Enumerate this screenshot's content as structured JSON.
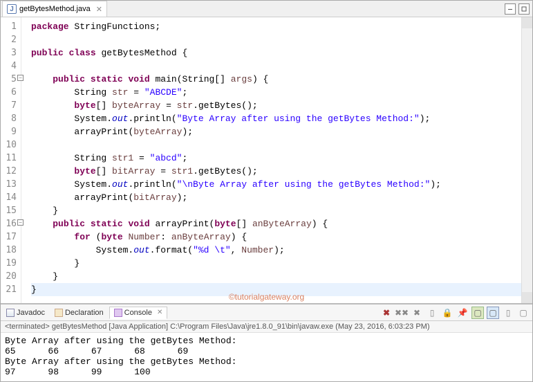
{
  "tab": {
    "filename": "getBytesMethod.java"
  },
  "code": {
    "lines": [
      {
        "n": 1,
        "html": "<span class='kw'>package</span> StringFunctions;"
      },
      {
        "n": 2,
        "html": ""
      },
      {
        "n": 3,
        "html": "<span class='kw'>public</span> <span class='kw'>class</span> getBytesMethod {"
      },
      {
        "n": 4,
        "html": ""
      },
      {
        "n": 5,
        "html": "    <span class='kw'>public</span> <span class='kw'>static</span> <span class='kw'>void</span> main(String[] <span class='mvar'>args</span>) {",
        "fold": true
      },
      {
        "n": 6,
        "html": "        String <span class='mvar'>str</span> = <span class='str'>\"ABCDE\"</span>;"
      },
      {
        "n": 7,
        "html": "        <span class='kw'>byte</span>[] <span class='mvar'>byteArray</span> = <span class='mvar'>str</span>.getBytes();"
      },
      {
        "n": 8,
        "html": "        System.<span class='field'>out</span>.println(<span class='str'>\"Byte Array after using the getBytes Method:\"</span>);"
      },
      {
        "n": 9,
        "html": "        <span class='cls'>arrayPrint</span>(<span class='mvar'>byteArray</span>);"
      },
      {
        "n": 10,
        "html": ""
      },
      {
        "n": 11,
        "html": "        String <span class='mvar'>str1</span> = <span class='str'>\"abcd\"</span>;"
      },
      {
        "n": 12,
        "html": "        <span class='kw'>byte</span>[] <span class='mvar'>bitArray</span> = <span class='mvar'>str1</span>.getBytes();"
      },
      {
        "n": 13,
        "html": "        System.<span class='field'>out</span>.println(<span class='str'>\"\\nByte Array after using the getBytes Method:\"</span>);"
      },
      {
        "n": 14,
        "html": "        <span class='cls'>arrayPrint</span>(<span class='mvar'>bitArray</span>);"
      },
      {
        "n": 15,
        "html": "    }"
      },
      {
        "n": 16,
        "html": "    <span class='kw'>public</span> <span class='kw'>static</span> <span class='kw'>void</span> arrayPrint(<span class='kw'>byte</span>[] <span class='mvar'>anByteArray</span>) {",
        "fold": true
      },
      {
        "n": 17,
        "html": "        <span class='kw'>for</span> (<span class='kw'>byte</span> <span class='mvar'>Number</span>: <span class='mvar'>anByteArray</span>) {"
      },
      {
        "n": 18,
        "html": "            System.<span class='field'>out</span>.format(<span class='str'>\"%d \\t\"</span>, <span class='mvar'>Number</span>);"
      },
      {
        "n": 19,
        "html": "        }"
      },
      {
        "n": 20,
        "html": "    }"
      },
      {
        "n": 21,
        "html": "}",
        "hl": true
      }
    ]
  },
  "watermark": "©tutorialgateway.org",
  "panels": {
    "tabs": [
      {
        "label": "Javadoc",
        "active": false
      },
      {
        "label": "Declaration",
        "active": false
      },
      {
        "label": "Console",
        "active": true
      }
    ],
    "runinfo": "<terminated> getBytesMethod [Java Application] C:\\Program Files\\Java\\jre1.8.0_91\\bin\\javaw.exe (May 23, 2016, 6:03:23 PM)",
    "output": "Byte Array after using the getBytes Method:\n65 \t66 \t67 \t68 \t69 \t\nByte Array after using the getBytes Method:\n97 \t98 \t99 \t100 \t"
  }
}
